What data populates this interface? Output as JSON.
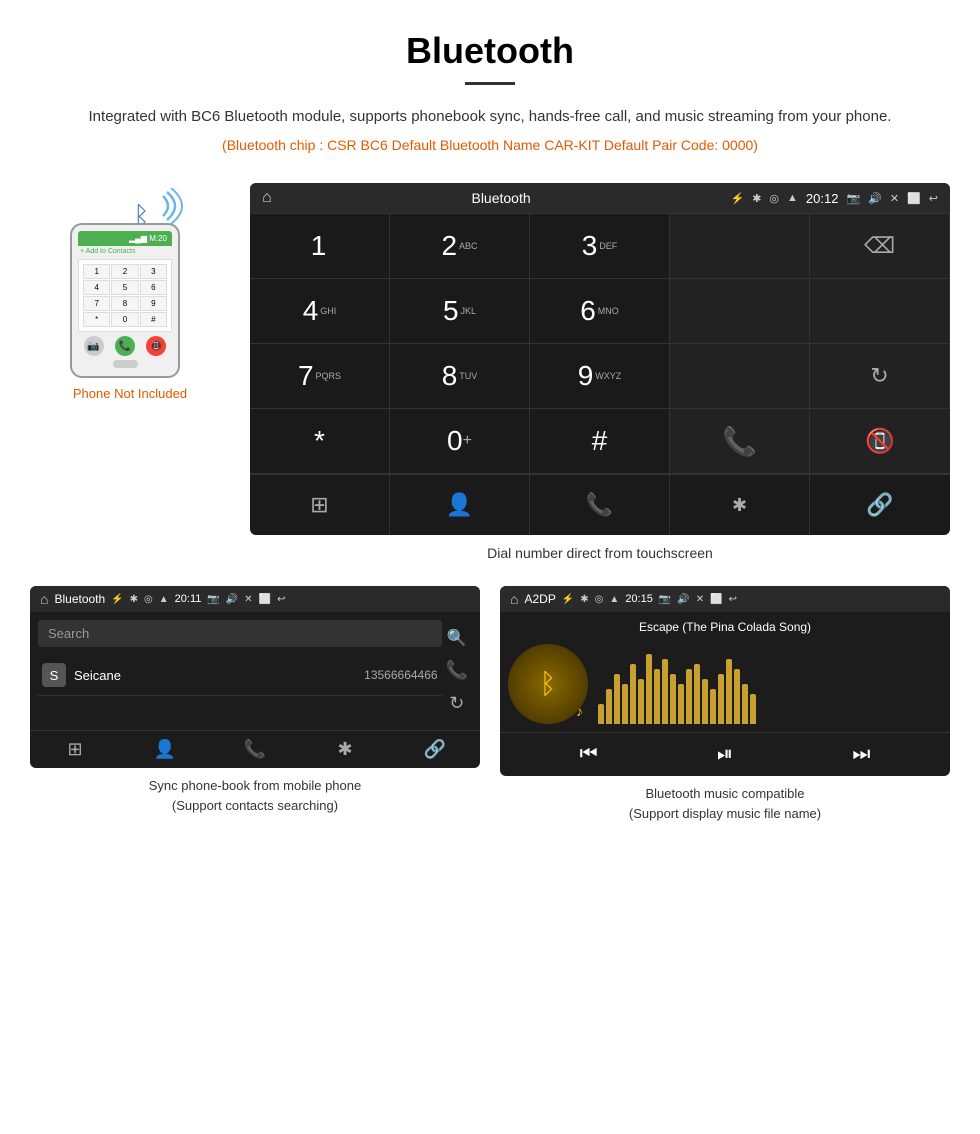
{
  "page": {
    "title": "Bluetooth",
    "description": "Integrated with BC6 Bluetooth module, supports phonebook sync, hands-free call, and music streaming from your phone.",
    "specs": "(Bluetooth chip : CSR BC6    Default Bluetooth Name CAR-KIT    Default Pair Code: 0000)"
  },
  "phone": {
    "not_included_label": "Phone Not Included",
    "top_bar_text": "M:20",
    "add_contact": "+ Add to Contacts",
    "keys": [
      "1",
      "2",
      "3",
      "4",
      "5",
      "6",
      "7",
      "8",
      "9",
      "*",
      "0",
      "#"
    ]
  },
  "dial_screen": {
    "title": "Bluetooth",
    "time": "20:12",
    "keys": [
      {
        "main": "1",
        "sub": ""
      },
      {
        "main": "2",
        "sub": "ABC"
      },
      {
        "main": "3",
        "sub": "DEF"
      },
      {
        "main": "",
        "sub": ""
      },
      {
        "main": "⌫",
        "sub": ""
      },
      {
        "main": "4",
        "sub": "GHI"
      },
      {
        "main": "5",
        "sub": "JKL"
      },
      {
        "main": "6",
        "sub": "MNO"
      },
      {
        "main": "",
        "sub": ""
      },
      {
        "main": "",
        "sub": ""
      },
      {
        "main": "7",
        "sub": "PQRS"
      },
      {
        "main": "8",
        "sub": "TUV"
      },
      {
        "main": "9",
        "sub": "WXYZ"
      },
      {
        "main": "",
        "sub": ""
      },
      {
        "main": "↻",
        "sub": ""
      },
      {
        "main": "*",
        "sub": ""
      },
      {
        "main": "0",
        "sub": "+"
      },
      {
        "main": "#",
        "sub": ""
      },
      {
        "main": "☎",
        "sub": "green"
      },
      {
        "main": "☎",
        "sub": "red"
      }
    ],
    "caption": "Dial number direct from touchscreen",
    "bottom_icons": [
      "⊞",
      "👤",
      "☎",
      "✱",
      "🔗"
    ]
  },
  "phonebook_screen": {
    "title": "Bluetooth",
    "time": "20:11",
    "search_placeholder": "Search",
    "contact_letter": "S",
    "contact_name": "Seicane",
    "contact_number": "13566664466",
    "bottom_icons": [
      "⊞",
      "👤",
      "☎",
      "✱",
      "🔗"
    ],
    "caption_line1": "Sync phone-book from mobile phone",
    "caption_line2": "(Support contacts searching)"
  },
  "music_screen": {
    "title": "A2DP",
    "time": "20:15",
    "song_title": "Escape (The Pina Colada Song)",
    "visualizer_bars": [
      20,
      35,
      50,
      40,
      60,
      45,
      70,
      55,
      65,
      50,
      40,
      55,
      60,
      45,
      35,
      50,
      65,
      55,
      40,
      30
    ],
    "caption_line1": "Bluetooth music compatible",
    "caption_line2": "(Support display music file name)"
  }
}
